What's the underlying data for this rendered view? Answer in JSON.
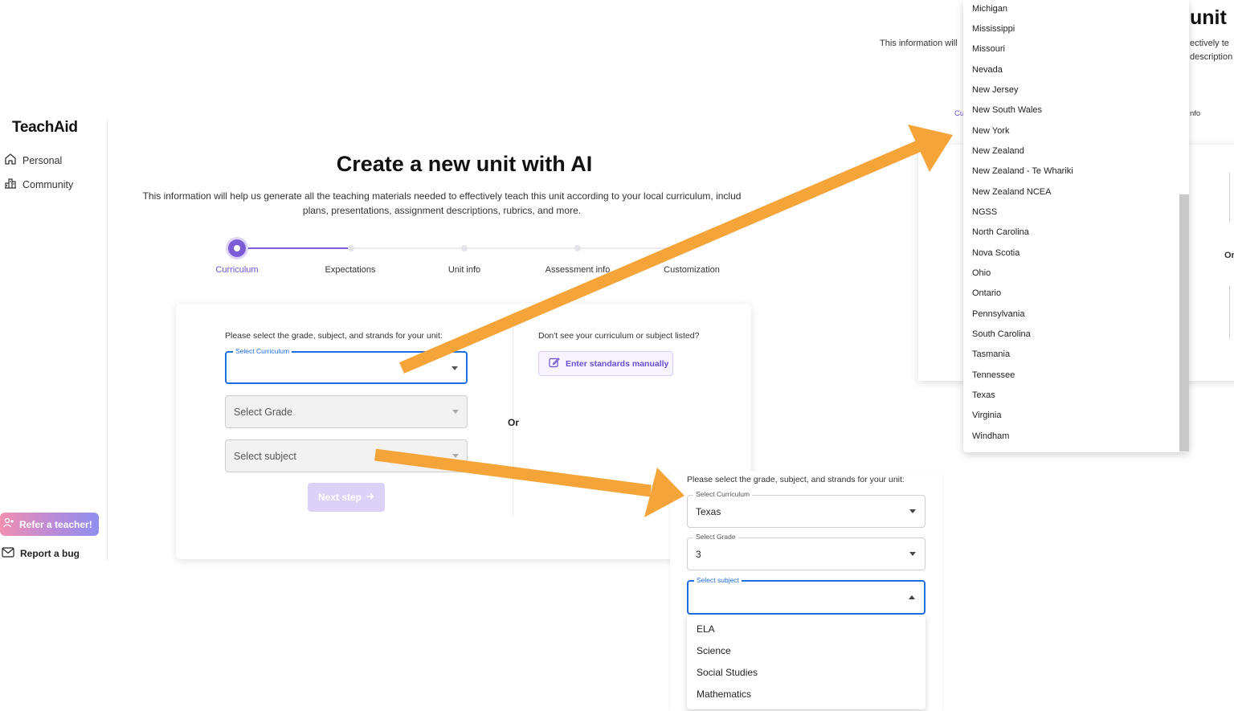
{
  "sidebar": {
    "brand": "TeachAid",
    "nav": [
      {
        "label": "Personal",
        "icon": "home-icon"
      },
      {
        "label": "Community",
        "icon": "community-icon"
      }
    ],
    "refer_label": "Refer a teacher!",
    "report_label": "Report a bug"
  },
  "main": {
    "title": "Create a new unit with AI",
    "description_line1": "This information will help us generate all the teaching materials needed to effectively teach this unit according to your local curriculum, includ",
    "description_line2": "plans, presentations, assignment descriptions, rubrics, and more.",
    "steps": [
      "Curriculum",
      "Expectations",
      "Unit info",
      "Assessment info",
      "Customization"
    ],
    "form": {
      "instruction": "Please select the grade, subject, and strands for your unit:",
      "curriculum_legend": "Select Curriculum",
      "grade_placeholder": "Select Grade",
      "subject_placeholder": "Select subject",
      "next_label": "Next step",
      "or_label": "Or",
      "manual_prompt": "Don't see your curriculum or subject listed?",
      "manual_button": "Enter standards manually"
    }
  },
  "top_right": {
    "title_fragment": "unit",
    "desc_left": "This information will",
    "desc_right_1": "ectively te",
    "desc_right_2": "description",
    "step_left": "Cu",
    "step_right": "nfo",
    "or_fragment": "Or",
    "curriculum_options": [
      "Michigan",
      "Mississippi",
      "Missouri",
      "Nevada",
      "New Jersey",
      "New South Wales",
      "New York",
      "New Zealand",
      "New Zealand - Te Whariki",
      "New Zealand NCEA",
      "NGSS",
      "North Carolina",
      "Nova Scotia",
      "Ohio",
      "Ontario",
      "Pennsylvania",
      "South Carolina",
      "Tasmania",
      "Tennessee",
      "Texas",
      "Virginia",
      "Windham"
    ]
  },
  "bottom_right": {
    "instruction": "Please select the grade, subject, and strands for your unit:",
    "curriculum_legend": "Select Curriculum",
    "curriculum_value": "Texas",
    "grade_legend": "Select Grade",
    "grade_value": "3",
    "subject_legend": "Select subject",
    "subject_options": [
      "ELA",
      "Science",
      "Social Studies",
      "Mathematics"
    ]
  },
  "colors": {
    "accent": "#7c5cd6",
    "focus": "#1f6fe0",
    "arrow": "#f5a43a"
  }
}
